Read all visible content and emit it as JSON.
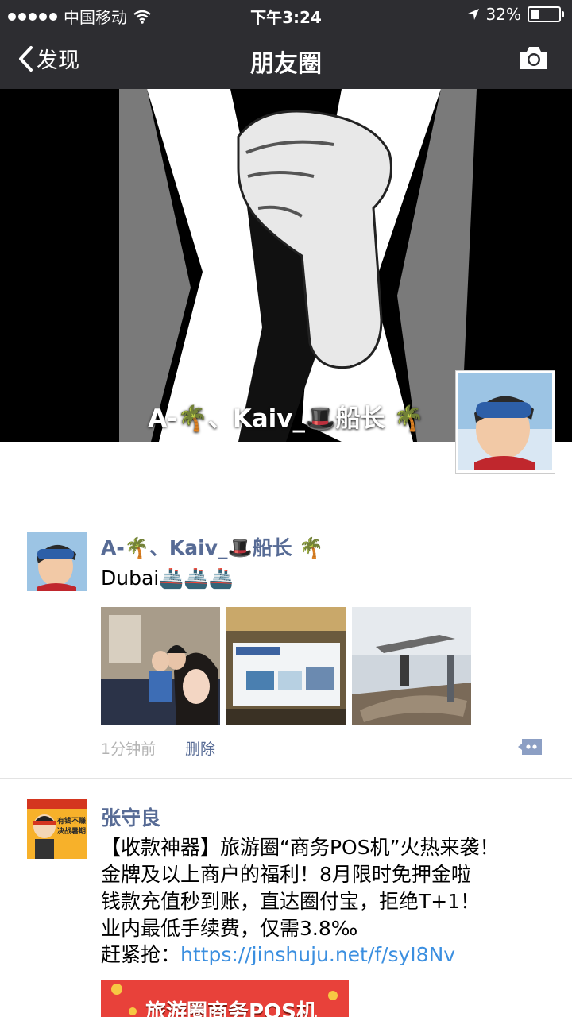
{
  "status": {
    "carrier": "中国移动",
    "time": "下午3:24",
    "battery": "32%",
    "battery_level": 0.32
  },
  "nav": {
    "back_label": "发现",
    "title": "朋友圈"
  },
  "cover": {
    "user_name": "A-🌴、Kaiv_🎩船长 🌴"
  },
  "posts": [
    {
      "author": "A-🌴、Kaiv_🎩船长 🌴",
      "text": "Dubai🚢🚢🚢",
      "time": "1分钟前",
      "delete_label": "删除"
    },
    {
      "author": "张守良",
      "lines": [
        "【收款神器】旅游圈“商务POS机”火热来袭！",
        "金牌及以上商户的福利！8月限时免押金啦",
        "钱款充值秒到账，直达圈付宝，拒绝T+1！",
        "业内最低手续费，仅需3.8‰"
      ],
      "link_prefix": "赶紧抢：",
      "link": "https://jinshuju.net/f/syI8Nv",
      "avatar_text": [
        "有钱不赚",
        "决战暑期"
      ],
      "ad_banner_text": "旅游圈商务POS机"
    }
  ],
  "colors": {
    "nav_bg": "#2d2d31",
    "name_link": "#576b95",
    "url_link": "#3b8fe0"
  }
}
